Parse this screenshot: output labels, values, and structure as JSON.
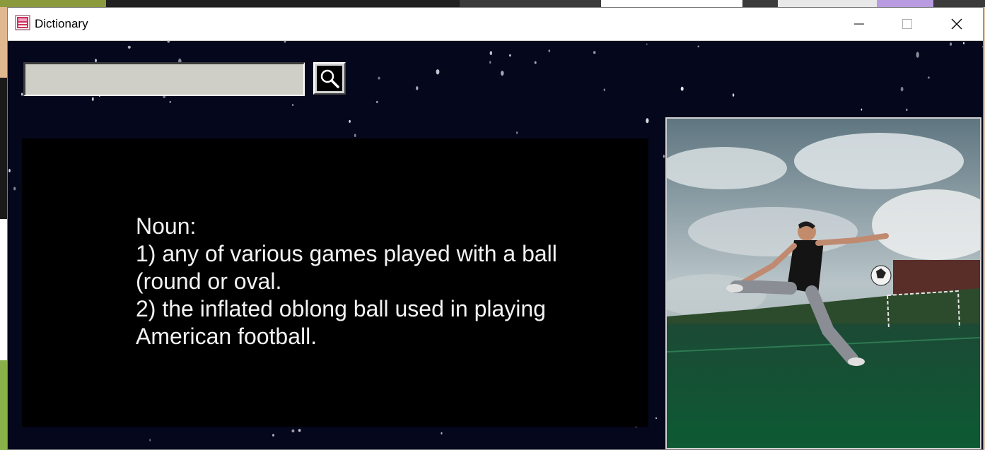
{
  "window": {
    "title": "Dictionary",
    "app_icon": "dictionary-app-icon"
  },
  "title_buttons": {
    "minimize_icon": "minimize-icon",
    "maximize_icon": "maximize-icon",
    "close_icon": "close-icon"
  },
  "search": {
    "value": "",
    "placeholder": "",
    "button_icon": "search-icon"
  },
  "definition": {
    "text": "Noun:\n1) any of various games played with a ball (round or oval.\n2) the inflated oblong ball used in playing American football."
  },
  "image": {
    "subject": "football-player-kicking-ball-photo"
  },
  "colors": {
    "client_bg": "#05071c",
    "panel_bg": "#000000",
    "text": "#f2f2f2",
    "input_bg": "#cfcfc7"
  }
}
